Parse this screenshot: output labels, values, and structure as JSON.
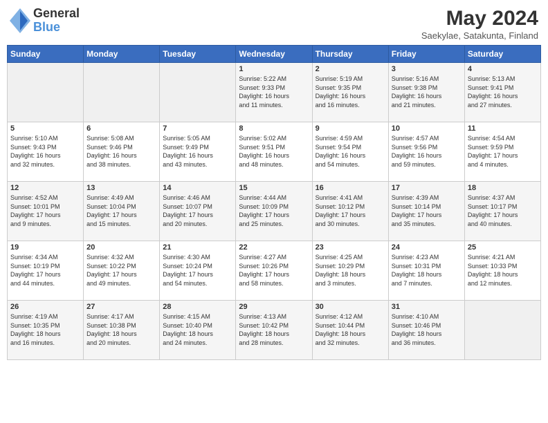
{
  "header": {
    "logo_general": "General",
    "logo_blue": "Blue",
    "month_title": "May 2024",
    "subtitle": "Saekylae, Satakunta, Finland"
  },
  "days_of_week": [
    "Sunday",
    "Monday",
    "Tuesday",
    "Wednesday",
    "Thursday",
    "Friday",
    "Saturday"
  ],
  "weeks": [
    [
      {
        "day": "",
        "info": ""
      },
      {
        "day": "",
        "info": ""
      },
      {
        "day": "",
        "info": ""
      },
      {
        "day": "1",
        "info": "Sunrise: 5:22 AM\nSunset: 9:33 PM\nDaylight: 16 hours\nand 11 minutes."
      },
      {
        "day": "2",
        "info": "Sunrise: 5:19 AM\nSunset: 9:35 PM\nDaylight: 16 hours\nand 16 minutes."
      },
      {
        "day": "3",
        "info": "Sunrise: 5:16 AM\nSunset: 9:38 PM\nDaylight: 16 hours\nand 21 minutes."
      },
      {
        "day": "4",
        "info": "Sunrise: 5:13 AM\nSunset: 9:41 PM\nDaylight: 16 hours\nand 27 minutes."
      }
    ],
    [
      {
        "day": "5",
        "info": "Sunrise: 5:10 AM\nSunset: 9:43 PM\nDaylight: 16 hours\nand 32 minutes."
      },
      {
        "day": "6",
        "info": "Sunrise: 5:08 AM\nSunset: 9:46 PM\nDaylight: 16 hours\nand 38 minutes."
      },
      {
        "day": "7",
        "info": "Sunrise: 5:05 AM\nSunset: 9:49 PM\nDaylight: 16 hours\nand 43 minutes."
      },
      {
        "day": "8",
        "info": "Sunrise: 5:02 AM\nSunset: 9:51 PM\nDaylight: 16 hours\nand 48 minutes."
      },
      {
        "day": "9",
        "info": "Sunrise: 4:59 AM\nSunset: 9:54 PM\nDaylight: 16 hours\nand 54 minutes."
      },
      {
        "day": "10",
        "info": "Sunrise: 4:57 AM\nSunset: 9:56 PM\nDaylight: 16 hours\nand 59 minutes."
      },
      {
        "day": "11",
        "info": "Sunrise: 4:54 AM\nSunset: 9:59 PM\nDaylight: 17 hours\nand 4 minutes."
      }
    ],
    [
      {
        "day": "12",
        "info": "Sunrise: 4:52 AM\nSunset: 10:01 PM\nDaylight: 17 hours\nand 9 minutes."
      },
      {
        "day": "13",
        "info": "Sunrise: 4:49 AM\nSunset: 10:04 PM\nDaylight: 17 hours\nand 15 minutes."
      },
      {
        "day": "14",
        "info": "Sunrise: 4:46 AM\nSunset: 10:07 PM\nDaylight: 17 hours\nand 20 minutes."
      },
      {
        "day": "15",
        "info": "Sunrise: 4:44 AM\nSunset: 10:09 PM\nDaylight: 17 hours\nand 25 minutes."
      },
      {
        "day": "16",
        "info": "Sunrise: 4:41 AM\nSunset: 10:12 PM\nDaylight: 17 hours\nand 30 minutes."
      },
      {
        "day": "17",
        "info": "Sunrise: 4:39 AM\nSunset: 10:14 PM\nDaylight: 17 hours\nand 35 minutes."
      },
      {
        "day": "18",
        "info": "Sunrise: 4:37 AM\nSunset: 10:17 PM\nDaylight: 17 hours\nand 40 minutes."
      }
    ],
    [
      {
        "day": "19",
        "info": "Sunrise: 4:34 AM\nSunset: 10:19 PM\nDaylight: 17 hours\nand 44 minutes."
      },
      {
        "day": "20",
        "info": "Sunrise: 4:32 AM\nSunset: 10:22 PM\nDaylight: 17 hours\nand 49 minutes."
      },
      {
        "day": "21",
        "info": "Sunrise: 4:30 AM\nSunset: 10:24 PM\nDaylight: 17 hours\nand 54 minutes."
      },
      {
        "day": "22",
        "info": "Sunrise: 4:27 AM\nSunset: 10:26 PM\nDaylight: 17 hours\nand 58 minutes."
      },
      {
        "day": "23",
        "info": "Sunrise: 4:25 AM\nSunset: 10:29 PM\nDaylight: 18 hours\nand 3 minutes."
      },
      {
        "day": "24",
        "info": "Sunrise: 4:23 AM\nSunset: 10:31 PM\nDaylight: 18 hours\nand 7 minutes."
      },
      {
        "day": "25",
        "info": "Sunrise: 4:21 AM\nSunset: 10:33 PM\nDaylight: 18 hours\nand 12 minutes."
      }
    ],
    [
      {
        "day": "26",
        "info": "Sunrise: 4:19 AM\nSunset: 10:35 PM\nDaylight: 18 hours\nand 16 minutes."
      },
      {
        "day": "27",
        "info": "Sunrise: 4:17 AM\nSunset: 10:38 PM\nDaylight: 18 hours\nand 20 minutes."
      },
      {
        "day": "28",
        "info": "Sunrise: 4:15 AM\nSunset: 10:40 PM\nDaylight: 18 hours\nand 24 minutes."
      },
      {
        "day": "29",
        "info": "Sunrise: 4:13 AM\nSunset: 10:42 PM\nDaylight: 18 hours\nand 28 minutes."
      },
      {
        "day": "30",
        "info": "Sunrise: 4:12 AM\nSunset: 10:44 PM\nDaylight: 18 hours\nand 32 minutes."
      },
      {
        "day": "31",
        "info": "Sunrise: 4:10 AM\nSunset: 10:46 PM\nDaylight: 18 hours\nand 36 minutes."
      },
      {
        "day": "",
        "info": ""
      }
    ]
  ]
}
